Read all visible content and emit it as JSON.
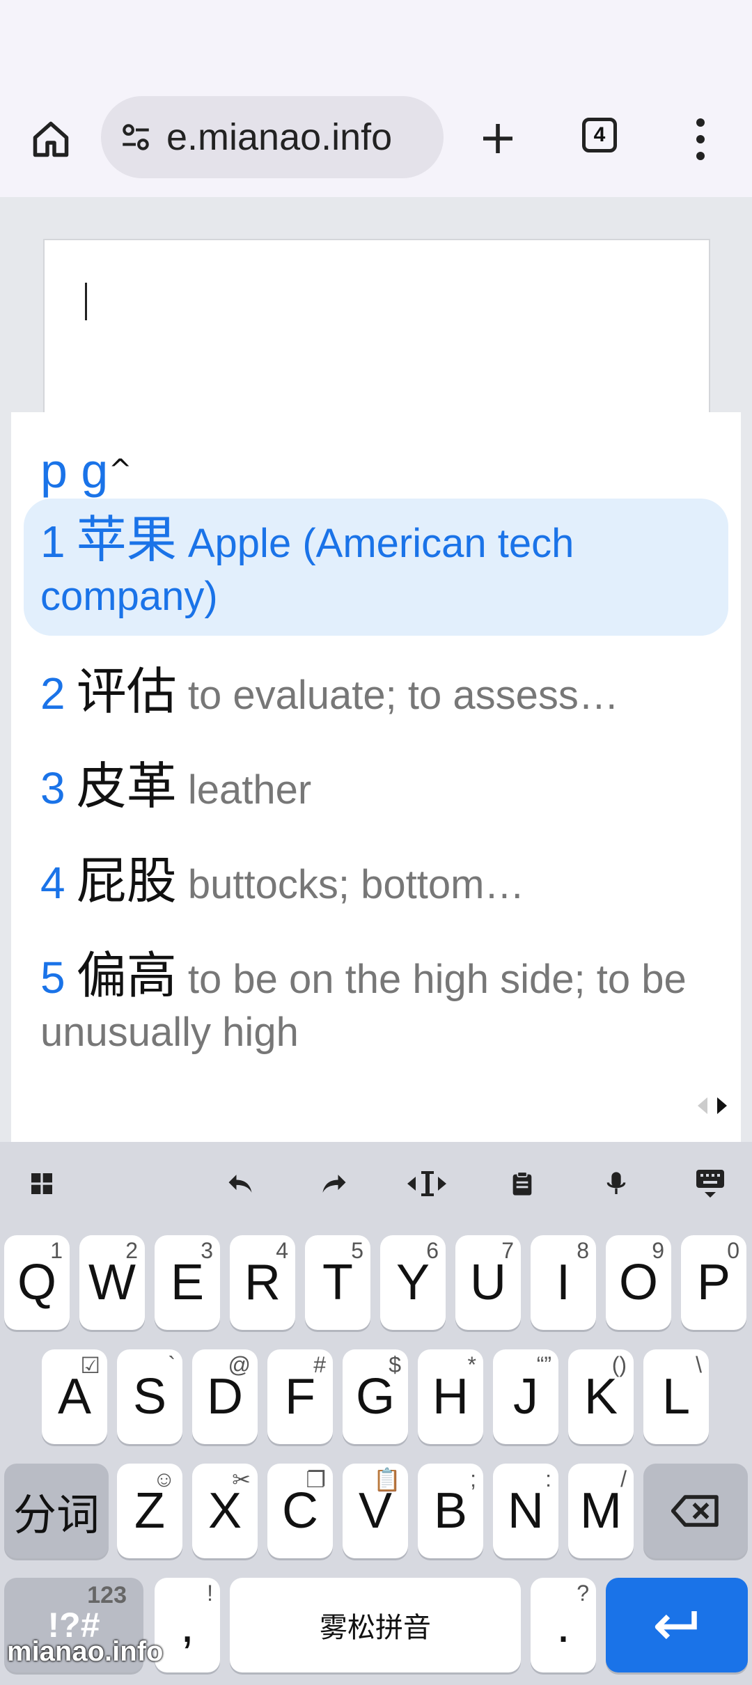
{
  "browser": {
    "url": "e.mianao.info",
    "tab_count": "4"
  },
  "ime": {
    "composition": "p g",
    "candidates": [
      {
        "num": "1",
        "hanzi": "苹果",
        "gloss": "Apple (American tech company)",
        "selected": true
      },
      {
        "num": "2",
        "hanzi": "评估",
        "gloss": "to evaluate; to assess…"
      },
      {
        "num": "3",
        "hanzi": "皮革",
        "gloss": "leather"
      },
      {
        "num": "4",
        "hanzi": "屁股",
        "gloss": "buttocks; bottom…"
      },
      {
        "num": "5",
        "hanzi": "偏高",
        "gloss": "to be on the high side; to be unusually high"
      }
    ]
  },
  "keyboard": {
    "row1": [
      {
        "label": "Q",
        "hint": "1"
      },
      {
        "label": "W",
        "hint": "2"
      },
      {
        "label": "E",
        "hint": "3"
      },
      {
        "label": "R",
        "hint": "4"
      },
      {
        "label": "T",
        "hint": "5"
      },
      {
        "label": "Y",
        "hint": "6"
      },
      {
        "label": "U",
        "hint": "7"
      },
      {
        "label": "I",
        "hint": "8"
      },
      {
        "label": "O",
        "hint": "9"
      },
      {
        "label": "P",
        "hint": "0"
      }
    ],
    "row2": [
      {
        "label": "A",
        "hint": "☑"
      },
      {
        "label": "S",
        "hint": "`"
      },
      {
        "label": "D",
        "hint": "@"
      },
      {
        "label": "F",
        "hint": "#"
      },
      {
        "label": "G",
        "hint": "$"
      },
      {
        "label": "H",
        "hint": "*"
      },
      {
        "label": "J",
        "hint": "“”"
      },
      {
        "label": "K",
        "hint": "()"
      },
      {
        "label": "L",
        "hint": "\\"
      }
    ],
    "row3": [
      {
        "label": "Z",
        "hint": "☺"
      },
      {
        "label": "X",
        "hint": "✂"
      },
      {
        "label": "C",
        "hint": "❐"
      },
      {
        "label": "V",
        "hint": "📋"
      },
      {
        "label": "B",
        "hint": ";"
      },
      {
        "label": "N",
        "hint": ":"
      },
      {
        "label": "M",
        "hint": "/"
      }
    ],
    "segment_label": "分词",
    "symbols_label": "!?#",
    "symbols_hint": "123",
    "comma_label": ",",
    "comma_hint": "!",
    "space_label": "雾松拼音",
    "period_label": ".",
    "period_hint": "?"
  },
  "watermark": "mianao.info"
}
